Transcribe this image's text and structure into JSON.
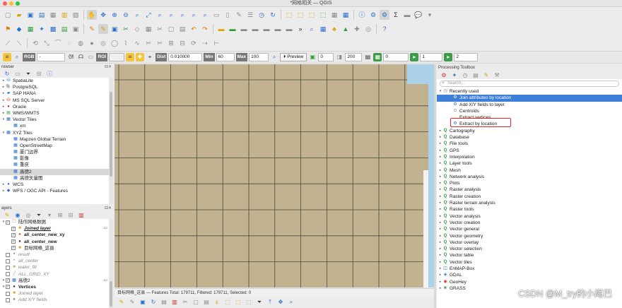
{
  "window": {
    "title": "*网格相关 — QGIS"
  },
  "style_toolbar": {
    "band_label": "RGB",
    "band_value": "-",
    "roi_label": "ROI",
    "dist_label": "Dist",
    "dist_value": "0.010000",
    "min_label": "Min",
    "min_value": "60",
    "max_label": "Max",
    "max_value": "100",
    "preview_label": "Preview",
    "field_a": "0",
    "field_b": "200",
    "spin1": "0",
    "spin2": "1",
    "spin3": "2"
  },
  "browser": {
    "title": "rowser",
    "items": [
      {
        "label": "SpatiaLite",
        "indent": 0,
        "icon": "spatialite-icon"
      },
      {
        "label": "PostgreSQL",
        "indent": 0,
        "icon": "postgresql-icon"
      },
      {
        "label": "SAP HANA",
        "indent": 0,
        "icon": "sap-hana-icon"
      },
      {
        "label": "MS SQL Server",
        "indent": 0,
        "icon": "mssql-icon"
      },
      {
        "label": "Oracle",
        "indent": 0,
        "icon": "oracle-icon"
      },
      {
        "label": "WMS/WMTS",
        "indent": 0,
        "icon": "wms-icon"
      },
      {
        "label": "Vector Tiles",
        "indent": 0,
        "icon": "vector-tiles-icon",
        "expanded": true
      },
      {
        "label": "xm",
        "indent": 1,
        "icon": "tile-layer-icon"
      },
      {
        "label": "XYZ Tiles",
        "indent": 0,
        "icon": "xyz-tiles-icon",
        "expanded": true
      },
      {
        "label": "Mapzen Global Terrain",
        "indent": 1,
        "icon": "xyz-layer-icon"
      },
      {
        "label": "OpenStreetMap",
        "indent": 1,
        "icon": "xyz-layer-icon"
      },
      {
        "label": "厦门边界",
        "indent": 1,
        "icon": "xyz-layer-icon"
      },
      {
        "label": "影像",
        "indent": 1,
        "icon": "xyz-layer-icon"
      },
      {
        "label": "重庆",
        "indent": 1,
        "icon": "xyz-layer-icon"
      },
      {
        "label": "高德2",
        "indent": 1,
        "icon": "xyz-layer-icon",
        "selected": true
      },
      {
        "label": "高德矢量图",
        "indent": 1,
        "icon": "xyz-layer-icon"
      },
      {
        "label": "WCS",
        "indent": 0,
        "icon": "wcs-icon"
      },
      {
        "label": "WFS / OGC API - Features",
        "indent": 0,
        "icon": "wfs-icon"
      }
    ]
  },
  "layers": {
    "title": "ayers",
    "items": [
      {
        "label": "陆作网格数据",
        "indent": 0,
        "checked": true,
        "kind": "group",
        "style": "group"
      },
      {
        "label": "Joined layer",
        "indent": 1,
        "checked": true,
        "kind": "polygon",
        "style": "bold-italic-underline"
      },
      {
        "label": "all_center_new_xy",
        "indent": 1,
        "checked": true,
        "kind": "point",
        "style": "bold"
      },
      {
        "label": "all_center_new",
        "indent": 1,
        "checked": true,
        "kind": "point-dark",
        "style": "bold"
      },
      {
        "label": "目标网格_这县",
        "indent": 1,
        "checked": true,
        "kind": "polygon",
        "style": "normal"
      },
      {
        "label": "result",
        "indent": 0,
        "checked": false,
        "kind": "point-red",
        "style": "italic-gray"
      },
      {
        "label": "all_center",
        "indent": 0,
        "checked": false,
        "kind": "point-gray",
        "style": "italic-gray"
      },
      {
        "label": "water_fill",
        "indent": 0,
        "checked": false,
        "kind": "polygon-green",
        "style": "italic-gray"
      },
      {
        "label": "ALL_GRID_XY",
        "indent": 0,
        "checked": false,
        "kind": "line",
        "style": "italic-gray"
      },
      {
        "label": "高德2",
        "indent": 0,
        "checked": true,
        "kind": "raster",
        "style": "normal"
      },
      {
        "label": "Vertices",
        "indent": 0,
        "checked": true,
        "kind": "point-dark",
        "style": "bold"
      },
      {
        "label": "Joined layer",
        "indent": 0,
        "checked": false,
        "kind": "polygon",
        "style": "italic-gray"
      },
      {
        "label": "Add X/Y fields",
        "indent": 0,
        "checked": false,
        "kind": "point",
        "style": "italic-gray"
      }
    ]
  },
  "map": {
    "status_text": "目标网格_这县 — Features Total: 179711, Filtered: 179711, Selected: 0",
    "fill_color": "#c2b290",
    "grid_color": "#4a4a40",
    "water_color": "#acd2e9"
  },
  "toolbox": {
    "title": "Processing Toolbox",
    "search_placeholder": "Search...",
    "recently_used_label": "Recently used",
    "recent": [
      {
        "label": "Join attributes by location",
        "highlighted": true
      },
      {
        "label": "Add X/Y fields to layer",
        "highlighted": false
      },
      {
        "label": "Centroids",
        "highlighted": false
      },
      {
        "label": "Extract vertices",
        "highlighted": false
      },
      {
        "label": "Extract by location",
        "highlighted": false
      }
    ],
    "groups": [
      "Cartography",
      "Database",
      "File tools",
      "GPS",
      "Interpolation",
      "Layer tools",
      "Mesh",
      "Network analysis",
      "Plots",
      "Raster analysis",
      "Raster creation",
      "Raster terrain analysis",
      "Raster tools",
      "Vector analysis",
      "Vector creation",
      "Vector general",
      "Vector geometry",
      "Vector overlay",
      "Vector selection",
      "Vector table",
      "Vector tiles",
      "EnMAP-Box",
      "GDAL",
      "GeoHey",
      "GRASS"
    ]
  },
  "watermark": "CSDN @M_try的小尾巴"
}
